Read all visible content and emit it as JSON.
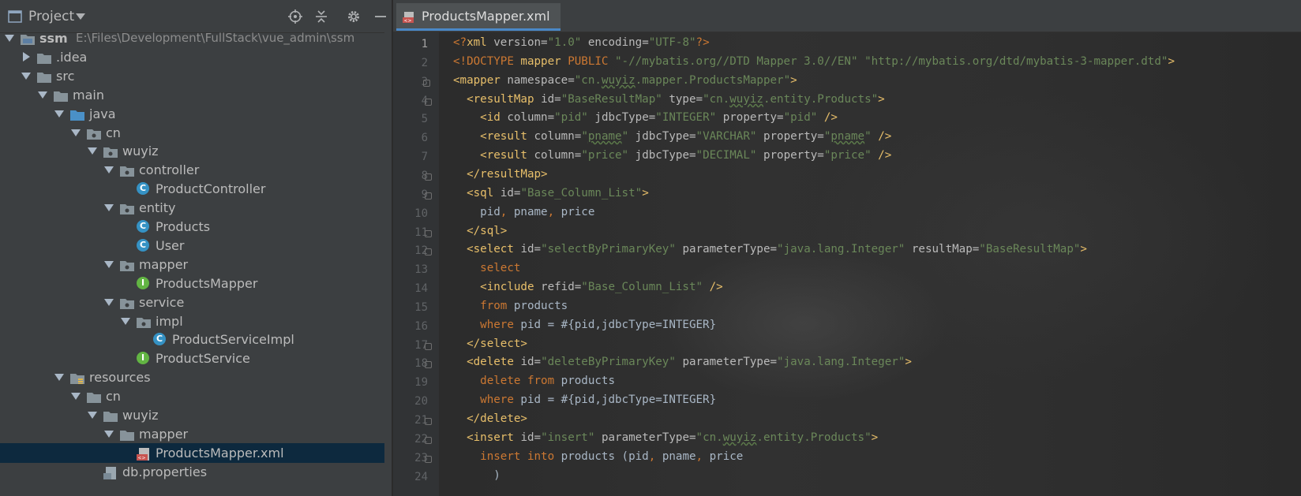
{
  "project_panel": {
    "title": "Project",
    "tree": [
      {
        "label": "ssm",
        "hint": "E:\\Files\\Development\\FullStack\\vue_admin\\ssm",
        "icon": "module-folder-icon",
        "depth": 0,
        "expanded": true,
        "bold": true
      },
      {
        "label": ".idea",
        "icon": "folder-icon",
        "depth": 1,
        "expanded": false
      },
      {
        "label": "src",
        "icon": "folder-icon",
        "depth": 1,
        "expanded": true
      },
      {
        "label": "main",
        "icon": "folder-icon",
        "depth": 2,
        "expanded": true
      },
      {
        "label": "java",
        "icon": "source-folder-icon",
        "depth": 3,
        "expanded": true
      },
      {
        "label": "cn",
        "icon": "package-icon",
        "depth": 4,
        "expanded": true
      },
      {
        "label": "wuyiz",
        "icon": "package-icon",
        "depth": 5,
        "expanded": true
      },
      {
        "label": "controller",
        "icon": "package-icon",
        "depth": 6,
        "expanded": true
      },
      {
        "label": "ProductController",
        "icon": "class-icon",
        "depth": 7
      },
      {
        "label": "entity",
        "icon": "package-icon",
        "depth": 6,
        "expanded": true
      },
      {
        "label": "Products",
        "icon": "class-icon",
        "depth": 7
      },
      {
        "label": "User",
        "icon": "class-icon",
        "depth": 7
      },
      {
        "label": "mapper",
        "icon": "package-icon",
        "depth": 6,
        "expanded": true
      },
      {
        "label": "ProductsMapper",
        "icon": "interface-icon",
        "depth": 7
      },
      {
        "label": "service",
        "icon": "package-icon",
        "depth": 6,
        "expanded": true
      },
      {
        "label": "impl",
        "icon": "package-icon",
        "depth": 7,
        "expanded": true
      },
      {
        "label": "ProductServiceImpl",
        "icon": "class-icon",
        "depth": 8
      },
      {
        "label": "ProductService",
        "icon": "interface-icon",
        "depth": 7
      },
      {
        "label": "resources",
        "icon": "resources-folder-icon",
        "depth": 3,
        "expanded": true
      },
      {
        "label": "cn",
        "icon": "folder-icon",
        "depth": 4,
        "expanded": true
      },
      {
        "label": "wuyiz",
        "icon": "folder-icon",
        "depth": 5,
        "expanded": true
      },
      {
        "label": "mapper",
        "icon": "folder-icon",
        "depth": 6,
        "expanded": true
      },
      {
        "label": "ProductsMapper.xml",
        "icon": "xml-file-icon",
        "depth": 7,
        "selected": true
      },
      {
        "label": "db.properties",
        "icon": "properties-file-icon",
        "depth": 5
      }
    ]
  },
  "editor": {
    "tab_label": "ProductsMapper.xml",
    "lines": [
      {
        "n": "1"
      },
      {
        "n": "2"
      },
      {
        "n": "3"
      },
      {
        "n": "4"
      },
      {
        "n": "5"
      },
      {
        "n": "6"
      },
      {
        "n": "7"
      },
      {
        "n": "8"
      },
      {
        "n": "9"
      },
      {
        "n": "10"
      },
      {
        "n": "11"
      },
      {
        "n": "12"
      },
      {
        "n": "13"
      },
      {
        "n": "14"
      },
      {
        "n": "15"
      },
      {
        "n": "16"
      },
      {
        "n": "17"
      },
      {
        "n": "18"
      },
      {
        "n": "19"
      },
      {
        "n": "20"
      },
      {
        "n": "21"
      },
      {
        "n": "22"
      },
      {
        "n": "23"
      },
      {
        "n": "24"
      }
    ],
    "code": [
      [
        [
          "k",
          "<?"
        ],
        [
          "t",
          "xml "
        ],
        [
          "a",
          "version="
        ],
        [
          "v",
          "\"1.0\""
        ],
        [
          "a",
          " encoding="
        ],
        [
          "v",
          "\"UTF-8\""
        ],
        [
          "k",
          "?>"
        ]
      ],
      [
        [
          "k",
          "<!DOCTYPE "
        ],
        [
          "t",
          "mapper "
        ],
        [
          "k",
          "PUBLIC "
        ],
        [
          "v",
          "\"-//mybatis.org//DTD Mapper 3.0//EN\""
        ],
        [
          "a",
          " "
        ],
        [
          "v",
          "\"http://mybatis.org/dtd/mybatis-3-mapper.dtd\""
        ],
        [
          "t",
          ">"
        ]
      ],
      [
        [
          "t",
          "<mapper "
        ],
        [
          "a",
          "namespace="
        ],
        [
          "v",
          "\"cn."
        ],
        [
          "vu",
          "wuyiz"
        ],
        [
          "v",
          ".mapper.ProductsMapper\""
        ],
        [
          "t",
          ">"
        ]
      ],
      [
        [
          "p",
          "  "
        ],
        [
          "t",
          "<resultMap "
        ],
        [
          "a",
          "id="
        ],
        [
          "v",
          "\"BaseResultMap\""
        ],
        [
          "a",
          " type="
        ],
        [
          "v",
          "\"cn."
        ],
        [
          "vu",
          "wuyiz"
        ],
        [
          "v",
          ".entity.Products\""
        ],
        [
          "t",
          ">"
        ]
      ],
      [
        [
          "p",
          "    "
        ],
        [
          "t",
          "<id "
        ],
        [
          "a",
          "column="
        ],
        [
          "v",
          "\"pid\""
        ],
        [
          "a",
          " jdbcType="
        ],
        [
          "v",
          "\"INTEGER\""
        ],
        [
          "a",
          " property="
        ],
        [
          "v",
          "\"pid\""
        ],
        [
          "t",
          " />"
        ]
      ],
      [
        [
          "p",
          "    "
        ],
        [
          "t",
          "<result "
        ],
        [
          "a",
          "column="
        ],
        [
          "v",
          "\""
        ],
        [
          "vu",
          "pname"
        ],
        [
          "v",
          "\""
        ],
        [
          "a",
          " jdbcType="
        ],
        [
          "v",
          "\"VARCHAR\""
        ],
        [
          "a",
          " property="
        ],
        [
          "v",
          "\""
        ],
        [
          "vu",
          "pname"
        ],
        [
          "v",
          "\""
        ],
        [
          "t",
          " />"
        ]
      ],
      [
        [
          "p",
          "    "
        ],
        [
          "t",
          "<result "
        ],
        [
          "a",
          "column="
        ],
        [
          "v",
          "\"price\""
        ],
        [
          "a",
          " jdbcType="
        ],
        [
          "v",
          "\"DECIMAL\""
        ],
        [
          "a",
          " property="
        ],
        [
          "v",
          "\"price\""
        ],
        [
          "t",
          " />"
        ]
      ],
      [
        [
          "p",
          "  "
        ],
        [
          "t",
          "</resultMap>"
        ]
      ],
      [
        [
          "p",
          "  "
        ],
        [
          "t",
          "<sql "
        ],
        [
          "a",
          "id="
        ],
        [
          "v",
          "\"Base_Column_List\""
        ],
        [
          "t",
          ">"
        ]
      ],
      [
        [
          "p",
          "    "
        ],
        [
          "p",
          "pid"
        ],
        [
          "k",
          ","
        ],
        [
          "p",
          " pname"
        ],
        [
          "k",
          ","
        ],
        [
          "p",
          " price"
        ]
      ],
      [
        [
          "p",
          "  "
        ],
        [
          "t",
          "</sql>"
        ]
      ],
      [
        [
          "p",
          "  "
        ],
        [
          "t",
          "<select "
        ],
        [
          "a",
          "id="
        ],
        [
          "v",
          "\"selectByPrimaryKey\""
        ],
        [
          "a",
          " parameterType="
        ],
        [
          "v",
          "\"java.lang.Integer\""
        ],
        [
          "a",
          " resultMap="
        ],
        [
          "v",
          "\"BaseResultMap\""
        ],
        [
          "t",
          ">"
        ]
      ],
      [
        [
          "p",
          "    "
        ],
        [
          "k",
          "select"
        ]
      ],
      [
        [
          "p",
          "    "
        ],
        [
          "t",
          "<include "
        ],
        [
          "a",
          "refid="
        ],
        [
          "v",
          "\"Base_Column_List\""
        ],
        [
          "t",
          " />"
        ]
      ],
      [
        [
          "p",
          "    "
        ],
        [
          "k",
          "from"
        ],
        [
          "p",
          " products"
        ]
      ],
      [
        [
          "p",
          "    "
        ],
        [
          "k",
          "where"
        ],
        [
          "p",
          " pid = #{pid,jdbcType=INTEGER}"
        ]
      ],
      [
        [
          "p",
          "  "
        ],
        [
          "t",
          "</select>"
        ]
      ],
      [
        [
          "p",
          "  "
        ],
        [
          "t",
          "<delete "
        ],
        [
          "a",
          "id="
        ],
        [
          "v",
          "\"deleteByPrimaryKey\""
        ],
        [
          "a",
          " parameterType="
        ],
        [
          "v",
          "\"java.lang.Integer\""
        ],
        [
          "t",
          ">"
        ]
      ],
      [
        [
          "p",
          "    "
        ],
        [
          "k",
          "delete from"
        ],
        [
          "p",
          " products"
        ]
      ],
      [
        [
          "p",
          "    "
        ],
        [
          "k",
          "where"
        ],
        [
          "p",
          " pid = #{pid,jdbcType=INTEGER}"
        ]
      ],
      [
        [
          "p",
          "  "
        ],
        [
          "t",
          "</delete>"
        ]
      ],
      [
        [
          "p",
          "  "
        ],
        [
          "t",
          "<insert "
        ],
        [
          "a",
          "id="
        ],
        [
          "v",
          "\"insert\""
        ],
        [
          "a",
          " parameterType="
        ],
        [
          "v",
          "\"cn."
        ],
        [
          "vu",
          "wuyiz"
        ],
        [
          "v",
          ".entity.Products\""
        ],
        [
          "t",
          ">"
        ]
      ],
      [
        [
          "p",
          "    "
        ],
        [
          "k",
          "insert into"
        ],
        [
          "p",
          " products (pid"
        ],
        [
          "k",
          ","
        ],
        [
          "p",
          " pname"
        ],
        [
          "k",
          ","
        ],
        [
          "p",
          " price"
        ]
      ],
      [
        [
          "p",
          "      )"
        ]
      ]
    ]
  },
  "colors": {
    "panel_bg": "#3c3f41",
    "editor_bg": "#2b2b2b",
    "selection": "#0d293e",
    "tag": "#e8bf6a",
    "string": "#6a8759",
    "keyword": "#cc7832"
  }
}
